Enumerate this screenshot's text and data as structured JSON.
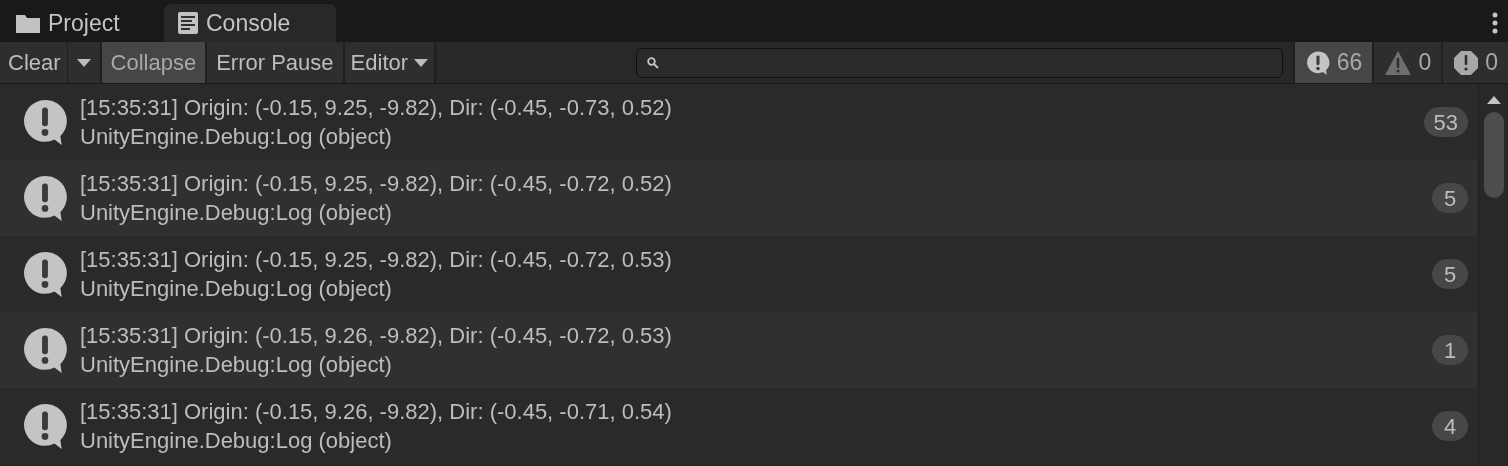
{
  "tabs": [
    {
      "label": "Project",
      "kind": "folder",
      "selected": false
    },
    {
      "label": "Console",
      "kind": "console",
      "selected": true
    }
  ],
  "toolbar": {
    "clear": "Clear",
    "toggles": [
      {
        "label": "Collapse",
        "selected": true
      },
      {
        "label": "Error Pause",
        "selected": false
      }
    ],
    "editor": "Editor"
  },
  "filters": [
    {
      "kind": "log",
      "count": "66",
      "selected": true
    },
    {
      "kind": "warning",
      "count": "0",
      "selected": false
    },
    {
      "kind": "error",
      "count": "0",
      "selected": false
    }
  ],
  "entries": [
    {
      "message": "[15:35:31] Origin: (-0.15, 9.25, -9.82), Dir: (-0.45, -0.73, 0.52)",
      "source": "UnityEngine.Debug:Log (object)",
      "count": "53"
    },
    {
      "message": "[15:35:31] Origin: (-0.15, 9.25, -9.82), Dir: (-0.45, -0.72, 0.52)",
      "source": "UnityEngine.Debug:Log (object)",
      "count": "5"
    },
    {
      "message": "[15:35:31] Origin: (-0.15, 9.25, -9.82), Dir: (-0.45, -0.72, 0.53)",
      "source": "UnityEngine.Debug:Log (object)",
      "count": "5"
    },
    {
      "message": "[15:35:31] Origin: (-0.15, 9.26, -9.82), Dir: (-0.45, -0.72, 0.53)",
      "source": "UnityEngine.Debug:Log (object)",
      "count": "1"
    },
    {
      "message": "[15:35:31] Origin: (-0.15, 9.26, -9.82), Dir: (-0.45, -0.71, 0.54)",
      "source": "UnityEngine.Debug:Log (object)",
      "count": "4"
    }
  ]
}
